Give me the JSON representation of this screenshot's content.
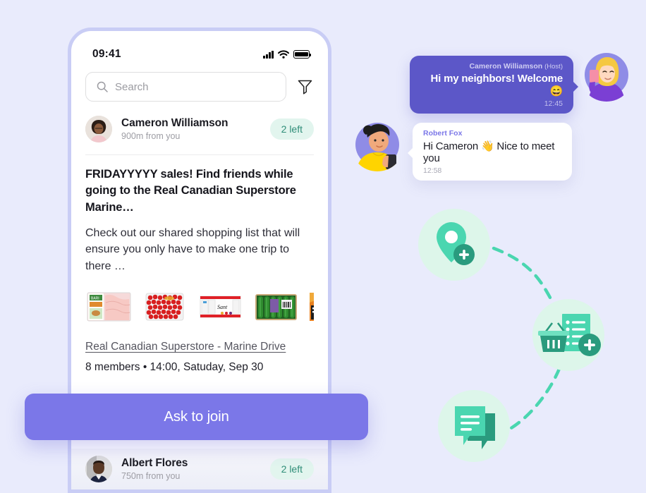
{
  "theme": {
    "background": "#e9ebfc",
    "accent_purple": "#7b77e8",
    "bubble_sent": "#5c57c8",
    "mint": "#4ad6b0",
    "mint_soft": "#dff6ec",
    "badge_bg": "#e2f5ee",
    "badge_text": "#2f8d78",
    "phone_border": "#c9cdf5"
  },
  "phone": {
    "statusbar": {
      "time": "09:41",
      "icons": [
        "signal-icon",
        "wifi-icon",
        "battery-icon"
      ]
    },
    "search": {
      "placeholder": "Search",
      "icon": "search-icon",
      "filter_icon": "filter-icon"
    },
    "host": {
      "name": "Cameron Williamson",
      "distance": "900m from you",
      "badge": "2 left",
      "avatar": "avatar-cameron"
    },
    "post": {
      "title": "FRIDAYYYYY sales! Find friends while going to the Real Canadian Superstore Marine…",
      "body": "Check out our shared shopping list that will ensure you only have to make one trip to there …",
      "thumbnails": [
        "chicken-breast-tray",
        "cherry-tomatoes-punnet",
        "yogurt-multipack",
        "cucumbers-tray",
        "juice-cartons"
      ],
      "store_link": "Real Canadian Superstore - Marine Drive",
      "meta": "8 members • 14:00, Satuday, Sep 30"
    },
    "next_listing": {
      "name": "Albert Flores",
      "distance": "750m from you",
      "badge": "2 left",
      "avatar": "avatar-albert"
    }
  },
  "cta": {
    "label": "Ask to join"
  },
  "chat": {
    "messages": [
      {
        "sender": "Cameron Williamson",
        "role": "(Host)",
        "text": "Hi my neighbors! Welcome 😄",
        "time": "12:45",
        "direction": "sent",
        "avatar": "avatar-blonde-woman-phone"
      },
      {
        "sender": "Robert Fox",
        "role": "",
        "text": "Hi Cameron 👋 Nice to meet you",
        "time": "12:58",
        "direction": "received",
        "avatar": "avatar-man-yellow-sweater"
      }
    ]
  },
  "illustration": {
    "nodes": [
      {
        "icon": "map-pin-add-icon",
        "label": "location"
      },
      {
        "icon": "basket-list-add-icon",
        "label": "shopping-list"
      },
      {
        "icon": "chat-bubbles-icon",
        "label": "chat"
      }
    ],
    "connector": "dashed-curve"
  }
}
